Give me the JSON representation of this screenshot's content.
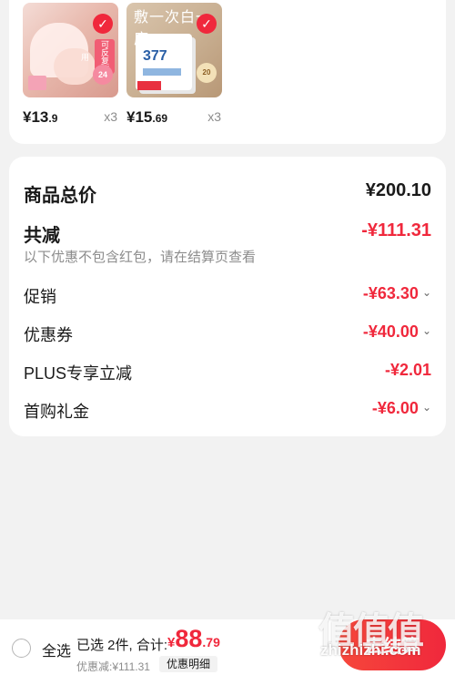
{
  "products": [
    {
      "price_int": "¥13",
      "price_dec": ".9",
      "qty": "x3",
      "image_icon": "nail-sticker-product-image",
      "art_text": {
        "tag": "可反复使用",
        "badge": "24"
      }
    },
    {
      "price_int": "¥15",
      "price_dec": ".69",
      "qty": "x3",
      "image_icon": "face-mask-product-image",
      "art_text": {
        "top": "敷一次白一度",
        "num": "377",
        "badge": "20"
      }
    }
  ],
  "totals": {
    "goods_total_label": "商品总价",
    "goods_total_value": "¥200.10",
    "reduction_label": "共减",
    "reduction_value": "-¥111.31",
    "note": "以下优惠不包含红包，请在结算页查看",
    "lines": [
      {
        "label": "促销",
        "value": "-¥63.30",
        "expandable": true
      },
      {
        "label": "优惠券",
        "value": "-¥40.00",
        "expandable": true
      },
      {
        "label": "PLUS专享立减",
        "value": "-¥2.01",
        "expandable": false
      },
      {
        "label": "首购礼金",
        "value": "-¥6.00",
        "expandable": true
      }
    ]
  },
  "bottom_bar": {
    "select_all": "全选",
    "summary": "已选 2件, 合计:",
    "total_yen": "¥",
    "total_int": "88",
    "total_dec": ".79",
    "discount_line": "优惠减:¥111.31",
    "detail_chip": "优惠明细",
    "checkout": "去结算"
  },
  "watermark": {
    "text": "zhizhizhi.com"
  },
  "colors": {
    "accent": "#f0283c",
    "muted": "#8c8c8c",
    "background": "#f2f2f2"
  }
}
